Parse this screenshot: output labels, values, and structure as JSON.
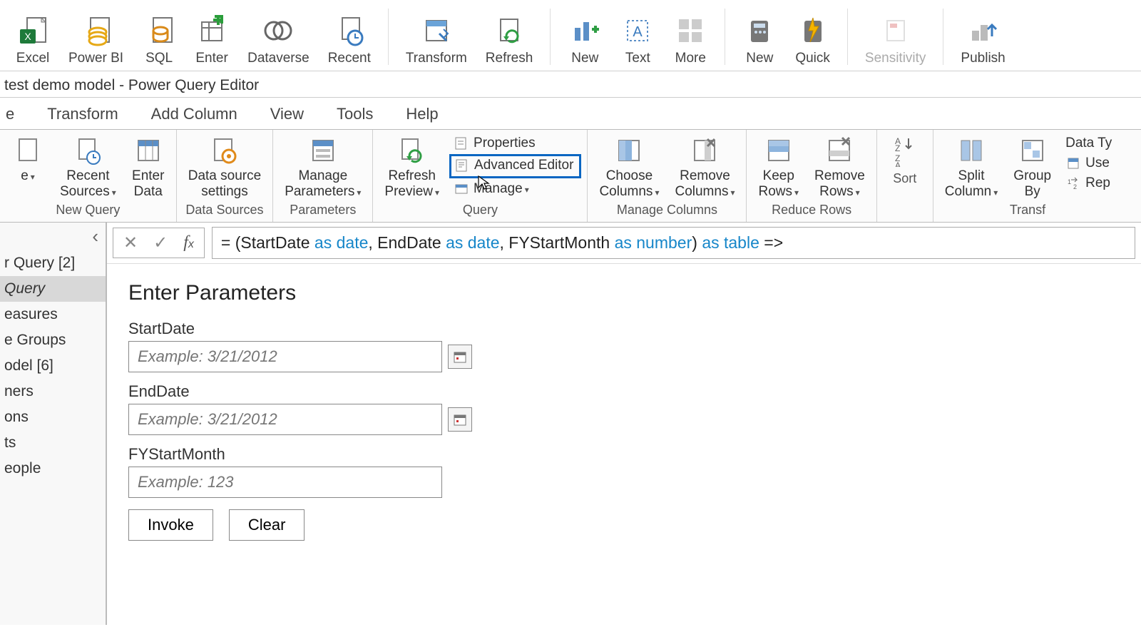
{
  "top_ribbon": {
    "excel": "Excel",
    "powerbi": "Power BI",
    "sql": "SQL",
    "enter": "Enter",
    "dataverse": "Dataverse",
    "recent": "Recent",
    "transform": "Transform",
    "refresh": "Refresh",
    "new": "New",
    "text": "Text",
    "more": "More",
    "new2": "New",
    "quick": "Quick",
    "sensitivity": "Sensitivity",
    "publish": "Publish"
  },
  "titlebar": "test demo model - Power Query Editor",
  "tabs": {
    "transform": "Transform",
    "addcolumn": "Add Column",
    "view": "View",
    "tools": "Tools",
    "help": "Help"
  },
  "ribbon": {
    "groups": {
      "new_query": "New Query",
      "data_sources": "Data Sources",
      "parameters": "Parameters",
      "query": "Query",
      "manage_columns": "Manage Columns",
      "reduce_rows": "Reduce Rows",
      "sort": "Sort",
      "transform": "Transf"
    },
    "buttons": {
      "recent_sources": "Recent\nSources",
      "enter_data": "Enter\nData",
      "data_source_settings": "Data source\nsettings",
      "manage_parameters": "Manage\nParameters",
      "refresh_preview": "Refresh\nPreview",
      "properties": "Properties",
      "advanced_editor": "Advanced Editor",
      "manage": "Manage",
      "choose_columns": "Choose\nColumns",
      "remove_columns": "Remove\nColumns",
      "keep_rows": "Keep\nRows",
      "remove_rows": "Remove\nRows",
      "split_column": "Split\nColumn",
      "group_by": "Group\nBy",
      "data_type": "Data Ty",
      "use": "Use",
      "replace": "Rep"
    }
  },
  "queries": {
    "header": "r Query [2]",
    "selected": "Query",
    "items": [
      "easures",
      "e Groups",
      "odel [6]",
      "ners",
      "ons",
      "ts",
      "eople"
    ]
  },
  "formula": {
    "parts": [
      "= (StartDate ",
      "as",
      " ",
      "date",
      ", EndDate ",
      "as",
      " ",
      "date",
      ", FYStartMonth ",
      "as",
      " ",
      "number",
      ") ",
      "as",
      " ",
      "table",
      " =>"
    ]
  },
  "params": {
    "title": "Enter Parameters",
    "start_label": "StartDate",
    "start_placeholder": "Example: 3/21/2012",
    "end_label": "EndDate",
    "end_placeholder": "Example: 3/21/2012",
    "fy_label": "FYStartMonth",
    "fy_placeholder": "Example: 123",
    "invoke": "Invoke",
    "clear": "Clear"
  }
}
